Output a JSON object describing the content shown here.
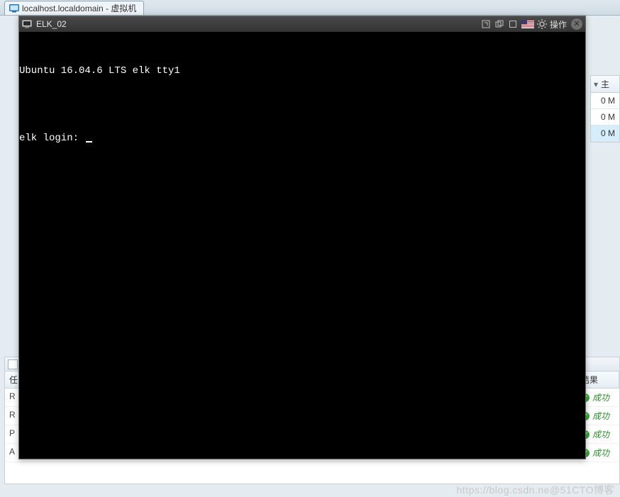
{
  "host_tab": {
    "label": "localhost.localdomain - 虚拟机"
  },
  "right_table": {
    "header": "主",
    "rows": [
      "0 M",
      "0 M",
      "0 M"
    ]
  },
  "lower_panel": {
    "columns": {
      "task": "任",
      "result": "结果"
    },
    "rows": [
      {
        "task": "R",
        "result": "成功"
      },
      {
        "task": "R",
        "result": "成功"
      },
      {
        "task": "P",
        "result": "成功"
      },
      {
        "task": "A",
        "result": "成功"
      }
    ]
  },
  "child_window": {
    "title": "ELK_02",
    "action_label": "操作"
  },
  "console": {
    "banner": "Ubuntu 16.04.6 LTS elk tty1",
    "prompt": "elk login: "
  },
  "watermark": "https://blog.csdn.ne@51CTO博客"
}
